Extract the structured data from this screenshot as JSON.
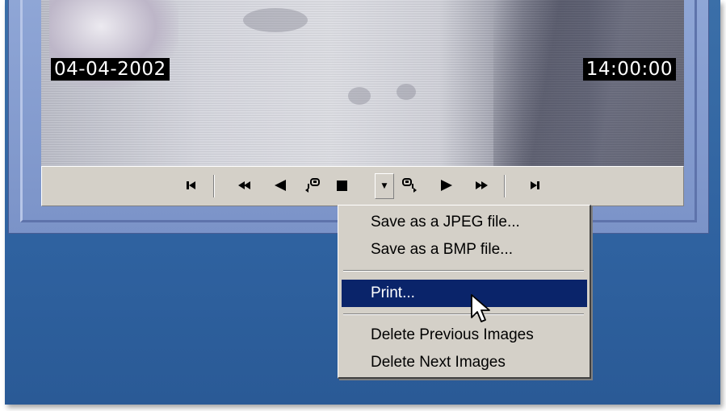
{
  "video": {
    "date_overlay": "04-04-2002",
    "time_overlay": "14:00:00"
  },
  "toolbar": {
    "buttons": [
      {
        "name": "first-frame-icon",
        "glyph": "▐◀"
      },
      {
        "name": "fast-rewind-icon",
        "glyph": "◀◀"
      },
      {
        "name": "step-back-icon",
        "glyph": "◀"
      },
      {
        "name": "prev-snapshot-icon",
        "glyph": "◫"
      },
      {
        "name": "stop-icon",
        "glyph": "■"
      },
      {
        "name": "next-snapshot-icon",
        "glyph": "◫"
      },
      {
        "name": "play-icon",
        "glyph": "▶"
      },
      {
        "name": "fast-forward-icon",
        "glyph": "▶▶"
      },
      {
        "name": "last-frame-icon",
        "glyph": "▶▌"
      }
    ],
    "dropdown_glyph": "▼"
  },
  "context_menu": {
    "items": [
      {
        "label": "Save as a JPEG file..."
      },
      {
        "label": "Save as a BMP file..."
      },
      {
        "label": "Print..."
      },
      {
        "label": "Delete Previous Images"
      },
      {
        "label": "Delete Next Images"
      }
    ],
    "selected_index": 2
  },
  "colors": {
    "desktop": "#2f62a0",
    "frame": "#7b93c8",
    "menu_bg": "#d4d0c8",
    "selection": "#0a246a"
  }
}
